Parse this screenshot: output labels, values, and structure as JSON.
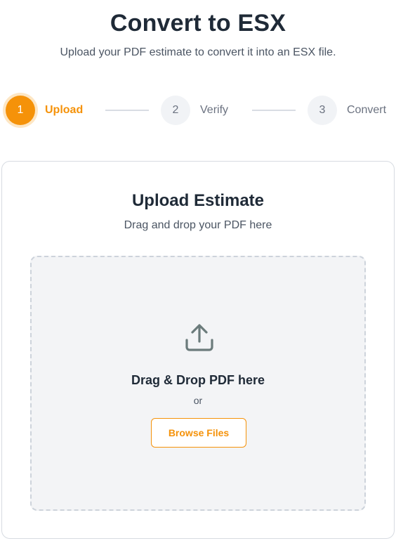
{
  "header": {
    "title": "Convert to ESX",
    "subtitle": "Upload your PDF estimate to convert it into an ESX file."
  },
  "stepper": {
    "steps": [
      {
        "number": "1",
        "label": "Upload",
        "state": "active"
      },
      {
        "number": "2",
        "label": "Verify",
        "state": "inactive"
      },
      {
        "number": "3",
        "label": "Convert",
        "state": "inactive"
      }
    ]
  },
  "upload_card": {
    "title": "Upload Estimate",
    "subtitle": "Drag and drop your PDF here",
    "dropzone": {
      "icon": "upload-icon",
      "title": "Drag & Drop PDF here",
      "or_text": "or",
      "browse_label": "Browse Files"
    }
  },
  "colors": {
    "accent": "#f59209",
    "heading": "#1f2a37",
    "muted": "#6b7280",
    "dropzone_bg": "#f3f4f6"
  }
}
